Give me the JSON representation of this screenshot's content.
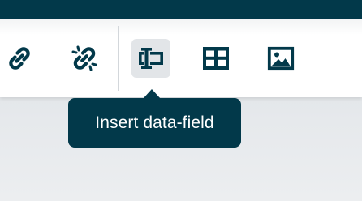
{
  "colors": {
    "dark": "#02394a",
    "icon": "#02394a",
    "active_button_bg": "#e2e5e8",
    "toolbar_bg": "#ffffff"
  },
  "toolbar": {
    "buttons": [
      {
        "name": "link",
        "icon": "link-icon",
        "active": false
      },
      {
        "name": "unlink",
        "icon": "unlink-icon",
        "active": false
      },
      {
        "name": "insert-data-field",
        "icon": "data-field-icon",
        "active": true
      },
      {
        "name": "table",
        "icon": "table-icon",
        "active": false
      },
      {
        "name": "image",
        "icon": "image-icon",
        "active": false
      }
    ]
  },
  "tooltip": {
    "text": "Insert data-field"
  }
}
